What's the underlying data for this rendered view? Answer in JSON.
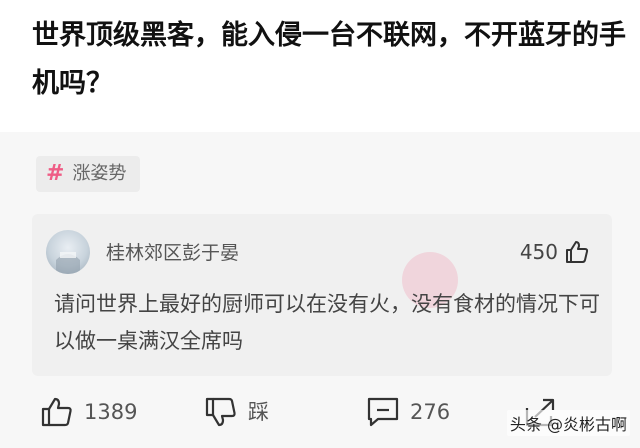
{
  "question": {
    "title": "世界顶级黑客，能入侵一台不联网，不开蓝牙的手机吗？"
  },
  "topic": {
    "hash": "#",
    "label": "涨姿势"
  },
  "answer": {
    "author": "桂林郊区彭于晏",
    "likes": "450",
    "text": "请问世界上最好的厨师可以在没有火，没有食材的情况下可以做一桌满汉全席吗"
  },
  "actions": {
    "like_count": "1389",
    "dislike_label": "踩",
    "comment_count": "276"
  },
  "watermark": "头条 @炎彬古啊",
  "colors": {
    "accent": "#ef5d86"
  },
  "icons": {
    "topic": "hash-icon",
    "answer_like": "thumbs-up-icon",
    "like": "thumbs-up-icon",
    "dislike": "thumbs-down-icon",
    "comment": "comment-icon",
    "share": "share-icon"
  }
}
